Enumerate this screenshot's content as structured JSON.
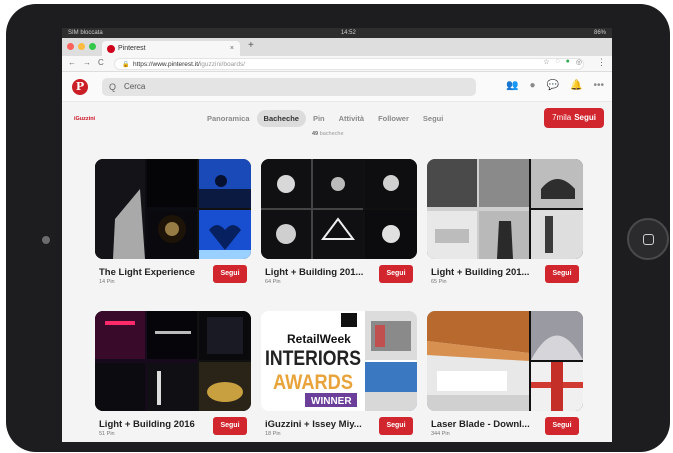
{
  "status": {
    "carrier": "SIM bloccata",
    "time": "14:52",
    "battery": "86%"
  },
  "browser": {
    "tab_title": "Pinterest",
    "close_glyph": "×",
    "new_tab_glyph": "+",
    "url_host": "https://www.pinterest.it/",
    "url_path": "iguzzini/boards/",
    "nav": {
      "back": "←",
      "forward": "→",
      "reload": "C"
    },
    "menu_glyph": "⋮"
  },
  "pinterest": {
    "logo_letter": "P",
    "search_placeholder": "Cerca",
    "search_icon": "Q",
    "brand": "iGuzzini",
    "tabs": [
      "Panoramica",
      "Bacheche",
      "Pin",
      "Attività",
      "Follower",
      "Segui"
    ],
    "active_tab": "Bacheche",
    "follower_count": "7mila",
    "follow_label": "Segui",
    "board_count_num": "49",
    "board_count_label": "bacheche"
  },
  "boards": [
    {
      "title": "The Light Experience",
      "pins": "14 Pin",
      "follow": "Segui"
    },
    {
      "title": "Light + Building 201...",
      "pins": "64 Pin",
      "follow": "Segui"
    },
    {
      "title": "Light + Building 201...",
      "pins": "65 Pin",
      "follow": "Segui"
    },
    {
      "title": "Light + Building 2016",
      "pins": "51 Pin",
      "follow": "Segui"
    },
    {
      "title": "iGuzzini + Issey Miy...",
      "pins": "18 Pin",
      "follow": "Segui"
    },
    {
      "title": "Laser Blade - Downl...",
      "pins": "344 Pin",
      "follow": "Segui"
    }
  ],
  "award_cover": {
    "line1": "RetailWeek",
    "line2": "INTERIORS",
    "line3": "AWARDS",
    "line4": "WINNER"
  },
  "colors": {
    "pinterest_red": "#d2262e",
    "device": "#1d1d1f"
  }
}
